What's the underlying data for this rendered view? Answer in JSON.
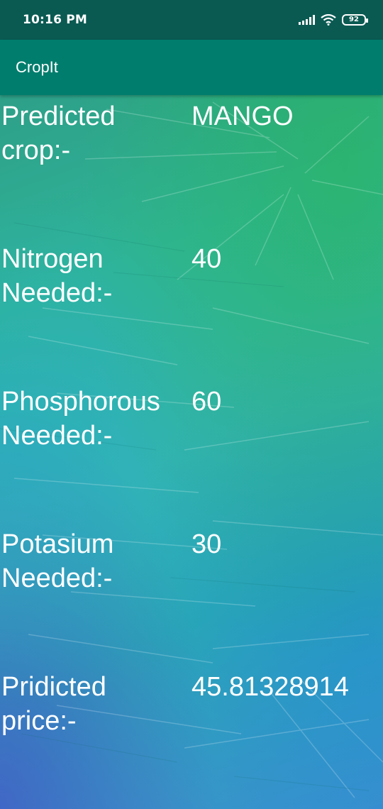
{
  "status_bar": {
    "time": "10:16 PM",
    "battery": "92",
    "icons": [
      "signal-icon",
      "wifi-icon",
      "battery-icon"
    ]
  },
  "app_bar": {
    "title": "CropIt"
  },
  "results": [
    {
      "label": "Predicted\ncrop:-",
      "value": "MANGO"
    },
    {
      "label": "Nitrogen\nNeeded:-",
      "value": "40"
    },
    {
      "label": "Phosphorous\nNeeded:-",
      "value": "60"
    },
    {
      "label": "Potasium\nNeeded:-",
      "value": "30"
    },
    {
      "label": "Pridicted\nprice:-",
      "value": "45.81328914"
    }
  ],
  "colors": {
    "status_bar": "#0a5a52",
    "app_bar": "#007d6d",
    "text": "#ffffff"
  }
}
